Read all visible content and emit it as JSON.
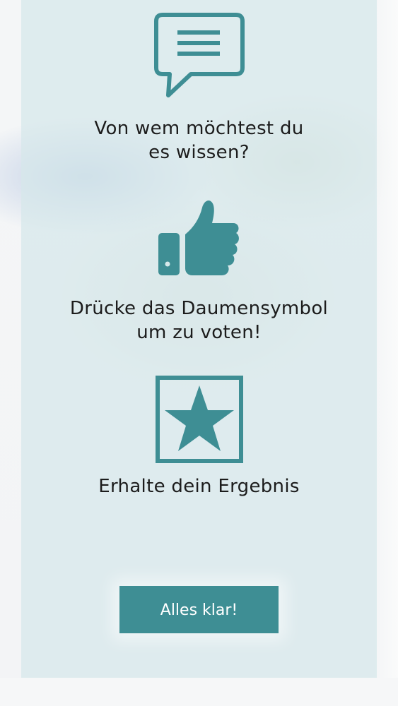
{
  "colors": {
    "accent": "#3e8e94",
    "text": "#1c1c1c",
    "button_text": "#ffffff"
  },
  "steps": [
    {
      "icon": "chat-icon",
      "line1": "Von wem möchtest du",
      "line2": "es wissen?"
    },
    {
      "icon": "thumbs-up-icon",
      "line1": "Drücke das Daumensymbol",
      "line2": "um zu voten!"
    },
    {
      "icon": "star-icon",
      "line1": "Erhalte dein Ergebnis",
      "line2": ""
    }
  ],
  "button": {
    "label": "Alles klar!"
  }
}
